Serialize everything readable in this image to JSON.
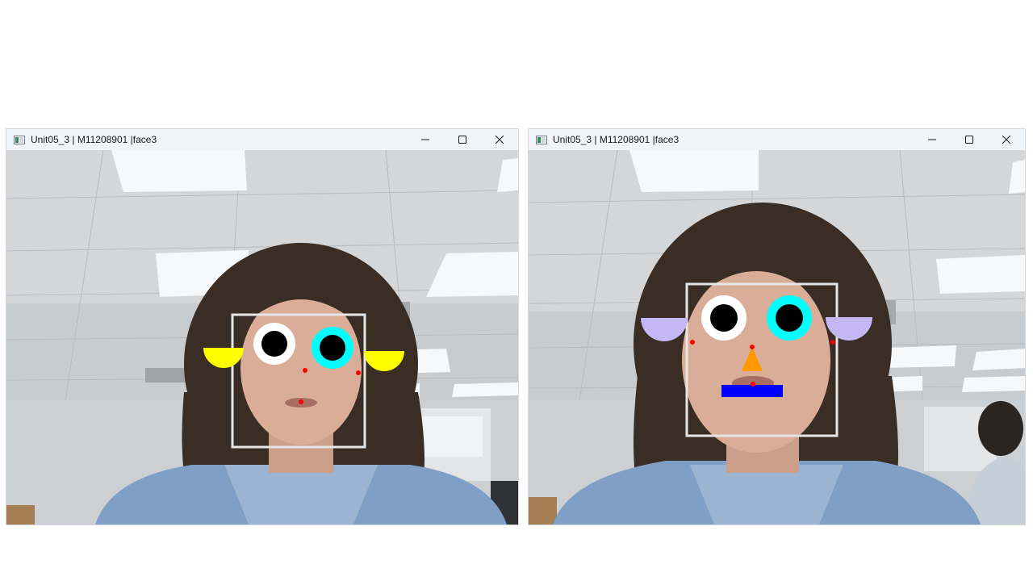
{
  "windows": [
    {
      "title": "Unit05_3 | M11208901 |face3",
      "controls": {
        "minimize": "minimize-icon",
        "maximize": "maximize-icon",
        "close": "close-icon"
      },
      "overlay": {
        "box_color": "#e6e6e6",
        "ear_color": "#ffff00",
        "left_iris_color": "#ffffff",
        "right_iris_color": "#00ffff",
        "pupil_color": "#000000",
        "landmark_color": "#ff0000"
      }
    },
    {
      "title": "Unit05_3 | M11208901 |face3",
      "controls": {
        "minimize": "minimize-icon",
        "maximize": "maximize-icon",
        "close": "close-icon"
      },
      "overlay": {
        "box_color": "#e6e6e6",
        "ear_color": "#c3b8f3",
        "left_iris_color": "#ffffff",
        "right_iris_color": "#00ffff",
        "pupil_color": "#000000",
        "landmark_color": "#ff0000",
        "nose_color": "#ff9900",
        "mouth_color": "#0000ff"
      }
    }
  ]
}
